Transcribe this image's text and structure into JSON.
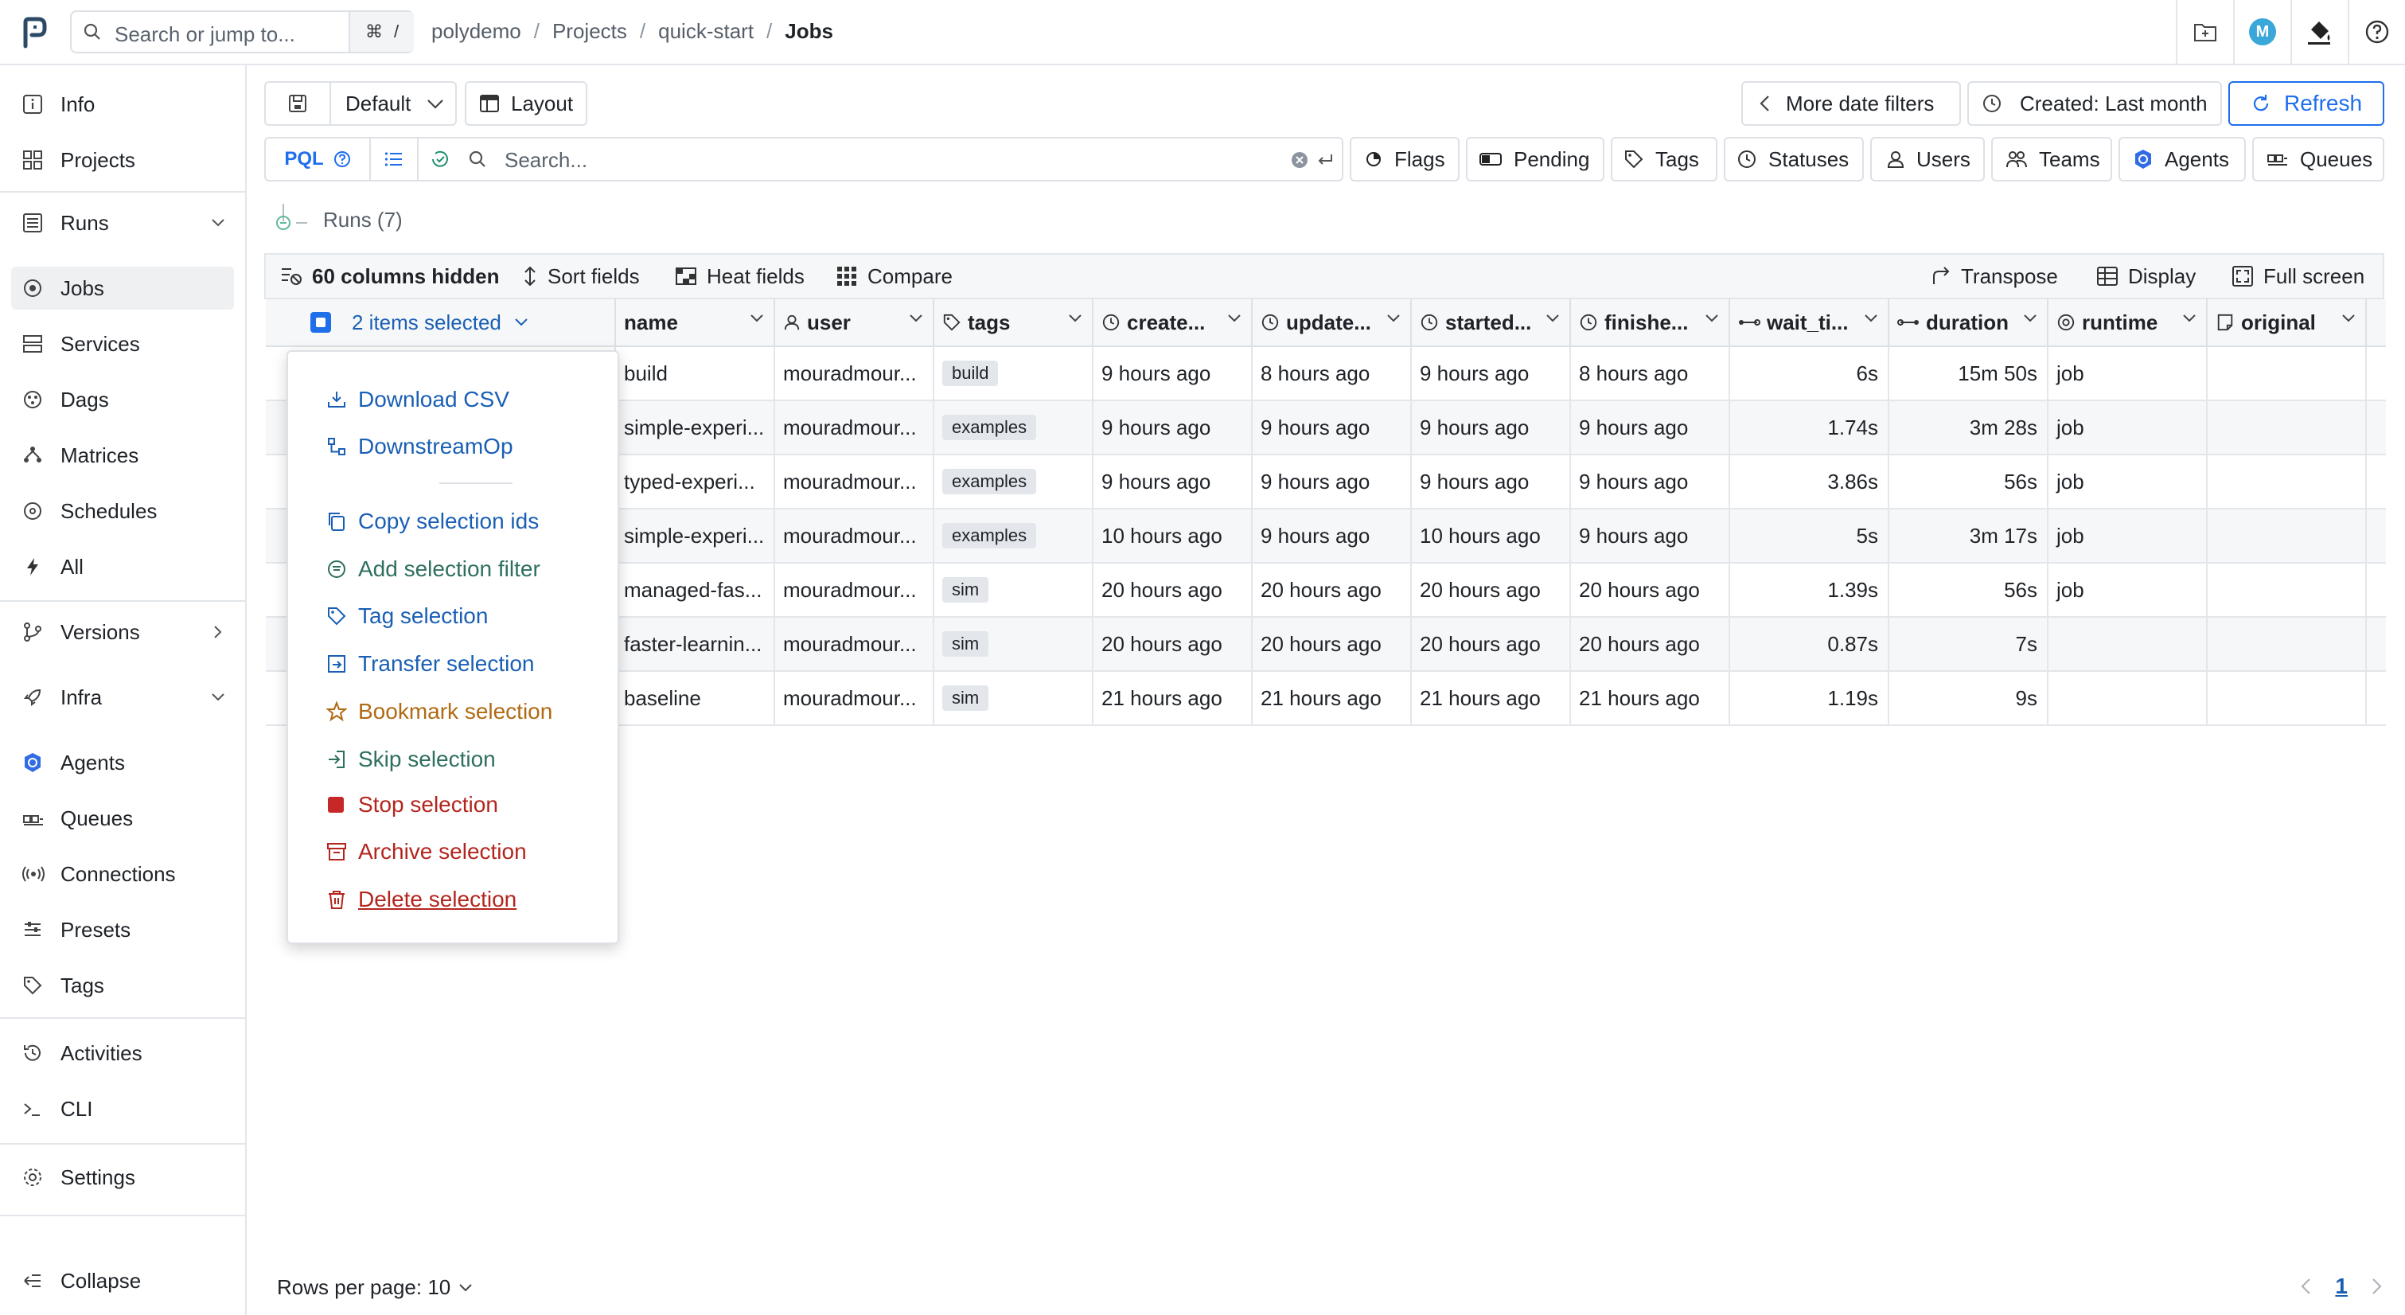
{
  "topbar": {
    "search_placeholder": "Search or jump to...",
    "kbd_cmd": "⌘",
    "kbd_slash": "/",
    "breadcrumbs": [
      "polydemo",
      "Projects",
      "quick-start",
      "Jobs"
    ],
    "avatar_initial": "M"
  },
  "sidebar": {
    "items": [
      {
        "label": "Info",
        "icon": "info-icon"
      },
      {
        "label": "Projects",
        "icon": "grid-icon"
      },
      {
        "label": "Runs",
        "icon": "list-icon"
      },
      {
        "label": "Jobs",
        "icon": "jobs-icon"
      },
      {
        "label": "Services",
        "icon": "server-icon"
      },
      {
        "label": "Dags",
        "icon": "dag-icon"
      },
      {
        "label": "Matrices",
        "icon": "matrix-icon"
      },
      {
        "label": "Schedules",
        "icon": "schedule-icon"
      },
      {
        "label": "All",
        "icon": "bolt-icon"
      },
      {
        "label": "Versions",
        "icon": "versions-icon"
      },
      {
        "label": "Infra",
        "icon": "rocket-icon"
      },
      {
        "label": "Agents",
        "icon": "agent-icon"
      },
      {
        "label": "Queues",
        "icon": "queue-icon"
      },
      {
        "label": "Connections",
        "icon": "connection-icon"
      },
      {
        "label": "Presets",
        "icon": "preset-icon"
      },
      {
        "label": "Tags",
        "icon": "tag-icon"
      },
      {
        "label": "Activities",
        "icon": "history-icon"
      },
      {
        "label": "CLI",
        "icon": "terminal-icon"
      },
      {
        "label": "Settings",
        "icon": "gear-icon"
      },
      {
        "label": "Collapse",
        "icon": "collapse-icon"
      }
    ]
  },
  "toolbar": {
    "default_label": "Default",
    "layout_label": "Layout",
    "more_date_filters": "More date filters",
    "created_filter": "Created: Last month",
    "refresh": "Refresh"
  },
  "query": {
    "pql": "PQL",
    "search_placeholder": "Search...",
    "filters": [
      "Flags",
      "Pending",
      "Tags",
      "Statuses",
      "Users",
      "Teams",
      "Agents",
      "Queues"
    ]
  },
  "runs_label": "Runs (7)",
  "table_toolbar": {
    "hidden": "60 columns hidden",
    "sort": "Sort fields",
    "heat": "Heat fields",
    "compare": "Compare",
    "transpose": "Transpose",
    "display": "Display",
    "fullscreen": "Full screen"
  },
  "table": {
    "selected_label": "2 items selected",
    "columns": [
      "name",
      "user",
      "tags",
      "create...",
      "update...",
      "started...",
      "finishe...",
      "wait_ti...",
      "duration",
      "runtime",
      "original"
    ],
    "rows": [
      {
        "name": "build",
        "user": "mouradmour...",
        "tag": "build",
        "created": "9 hours ago",
        "updated": "8 hours ago",
        "started": "9 hours ago",
        "finished": "8 hours ago",
        "wait": "6s",
        "duration": "15m 50s",
        "runtime": "job"
      },
      {
        "name": "simple-experi...",
        "user": "mouradmour...",
        "tag": "examples",
        "created": "9 hours ago",
        "updated": "9 hours ago",
        "started": "9 hours ago",
        "finished": "9 hours ago",
        "wait": "1.74s",
        "duration": "3m 28s",
        "runtime": "job"
      },
      {
        "name": "typed-experi...",
        "user": "mouradmour...",
        "tag": "examples",
        "created": "9 hours ago",
        "updated": "9 hours ago",
        "started": "9 hours ago",
        "finished": "9 hours ago",
        "wait": "3.86s",
        "duration": "56s",
        "runtime": "job"
      },
      {
        "name": "simple-experi...",
        "user": "mouradmour...",
        "tag": "examples",
        "created": "10 hours ago",
        "updated": "9 hours ago",
        "started": "10 hours ago",
        "finished": "9 hours ago",
        "wait": "5s",
        "duration": "3m 17s",
        "runtime": "job"
      },
      {
        "name": "managed-fas...",
        "user": "mouradmour...",
        "tag": "sim",
        "created": "20 hours ago",
        "updated": "20 hours ago",
        "started": "20 hours ago",
        "finished": "20 hours ago",
        "wait": "1.39s",
        "duration": "56s",
        "runtime": "job"
      },
      {
        "name": "faster-learnin...",
        "user": "mouradmour...",
        "tag": "sim",
        "created": "20 hours ago",
        "updated": "20 hours ago",
        "started": "20 hours ago",
        "finished": "20 hours ago",
        "wait": "0.87s",
        "duration": "7s",
        "runtime": ""
      },
      {
        "name": "baseline",
        "user": "mouradmour...",
        "tag": "sim",
        "created": "21 hours ago",
        "updated": "21 hours ago",
        "started": "21 hours ago",
        "finished": "21 hours ago",
        "wait": "1.19s",
        "duration": "9s",
        "runtime": ""
      }
    ]
  },
  "menu": {
    "download_csv": "Download CSV",
    "downstream": "DownstreamOp",
    "copy_ids": "Copy selection ids",
    "add_filter": "Add selection filter",
    "tag": "Tag selection",
    "transfer": "Transfer selection",
    "bookmark": "Bookmark selection",
    "skip": "Skip selection",
    "stop": "Stop selection",
    "archive": "Archive selection",
    "delete": "Delete selection"
  },
  "footer": {
    "rows_per_page": "Rows per page: 10",
    "page": "1"
  },
  "colors": {
    "accent": "#1f6feb",
    "danger": "#b3261e",
    "bookmark": "#b06a13",
    "menu_green": "#2e6f5f"
  }
}
